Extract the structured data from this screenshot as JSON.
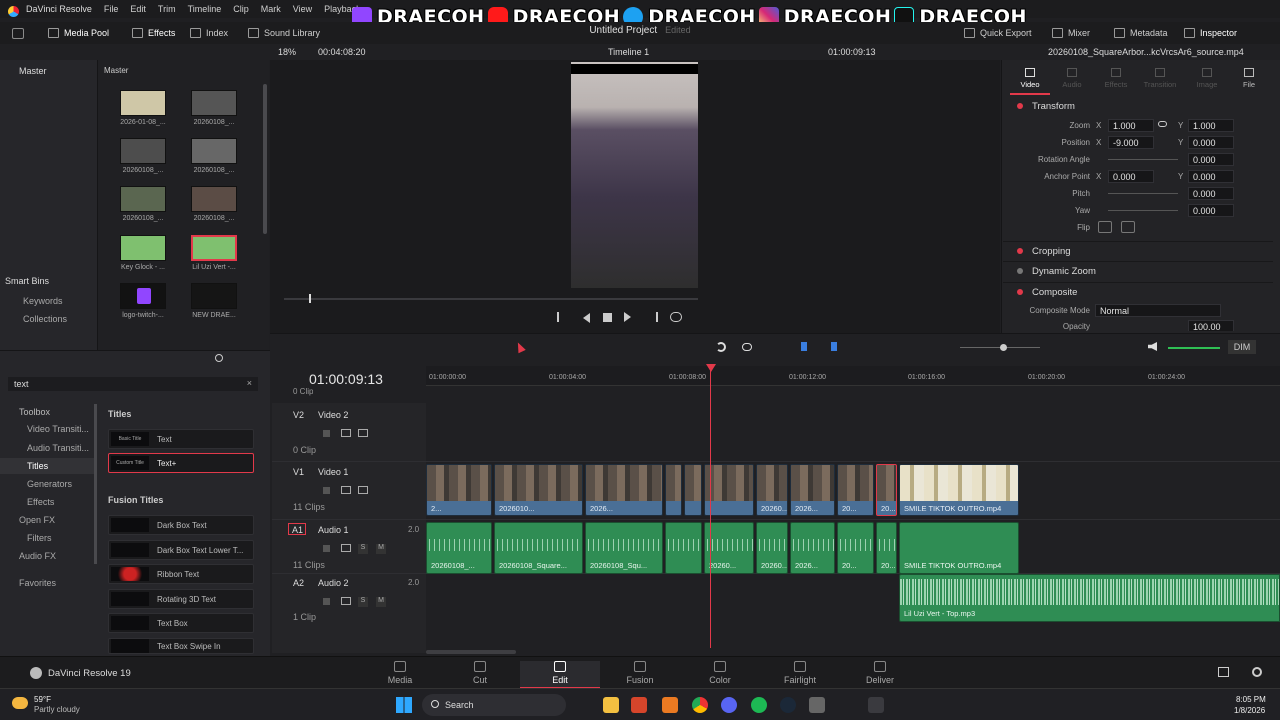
{
  "app_name": "DaVinci Resolve",
  "menu": [
    "File",
    "Edit",
    "Trim",
    "Timeline",
    "Clip",
    "Mark",
    "View",
    "Playback"
  ],
  "social_handles": [
    "DRAECOH",
    "DRAECOH",
    "DRAECOH",
    "DRAECOH",
    "DRAECOH"
  ],
  "project": {
    "title": "Untitled Project",
    "status": "Edited"
  },
  "toolbar": {
    "media_pool": "Media Pool",
    "effects": "Effects",
    "index": "Index",
    "sound_library": "Sound Library",
    "quick_export": "Quick Export",
    "mixer": "Mixer",
    "metadata": "Metadata",
    "inspector": "Inspector"
  },
  "viewer": {
    "zoom": "18%",
    "timecode_left": "00:04:08:20",
    "timeline_name": "Timeline 1",
    "timecode_right": "01:00:09:13",
    "source_name": "20260108_SquareArbor...kcVrcsAr6_source.mp4"
  },
  "bins": {
    "master": "Master",
    "pool_master": "Master",
    "smart_bins": "Smart Bins",
    "keywords": "Keywords",
    "collections": "Collections"
  },
  "media_items": [
    {
      "label": "2026-01-08_..."
    },
    {
      "label": "20260108_..."
    },
    {
      "label": "20260108_..."
    },
    {
      "label": "20260108_..."
    },
    {
      "label": "20260108_..."
    },
    {
      "label": "20260108_..."
    },
    {
      "label": "Key Glock - ..."
    },
    {
      "label": "Lil Uzi Vert -..."
    },
    {
      "label": "logo-twitch-..."
    },
    {
      "label": "NEW DRAE..."
    }
  ],
  "effects": {
    "search_value": "text",
    "tree": {
      "toolbox": "Toolbox",
      "video_transitions": "Video Transiti...",
      "audio_transitions": "Audio Transiti...",
      "titles": "Titles",
      "generators": "Generators",
      "effects": "Effects",
      "open_fx": "Open FX",
      "filters": "Filters",
      "audio_fx": "Audio FX",
      "favorites": "Favorites"
    },
    "titles_header": "Titles",
    "titles": [
      {
        "thumb": "Basic Title",
        "label": "Text"
      },
      {
        "thumb": "Custom Title",
        "label": "Text+"
      }
    ],
    "fusion_header": "Fusion Titles",
    "fusion_titles": [
      {
        "label": "Dark Box Text"
      },
      {
        "label": "Dark Box Text Lower T..."
      },
      {
        "label": "Ribbon Text"
      },
      {
        "label": "Rotating 3D Text"
      },
      {
        "label": "Text Box"
      },
      {
        "label": "Text Box Swipe In"
      }
    ]
  },
  "inspector": {
    "tabs": [
      "Video",
      "Audio",
      "Effects",
      "Transition",
      "Image",
      "File"
    ],
    "transform": "Transform",
    "zoom_label": "Zoom",
    "zoom_x": "1.000",
    "zoom_y": "1.000",
    "position_label": "Position",
    "pos_x": "-9.000",
    "pos_y": "0.000",
    "rotation_label": "Rotation Angle",
    "rotation": "0.000",
    "anchor_label": "Anchor Point",
    "anchor_x": "0.000",
    "anchor_y": "0.000",
    "pitch_label": "Pitch",
    "pitch": "0.000",
    "yaw_label": "Yaw",
    "yaw": "0.000",
    "flip_label": "Flip",
    "x": "X",
    "y": "Y",
    "cropping": "Cropping",
    "dynamic_zoom": "Dynamic Zoom",
    "composite": "Composite",
    "composite_mode_label": "Composite Mode",
    "composite_mode": "Normal",
    "opacity_label": "Opacity",
    "opacity": "100.00"
  },
  "timeline": {
    "timecode": "01:00:09:13",
    "ruler": [
      "01:00:00:00",
      "01:00:04:00",
      "01:00:08:00",
      "01:00:12:00",
      "01:00:16:00",
      "01:00:20:00",
      "01:00:24:00"
    ],
    "dim": "DIM",
    "top_clip": "0 Clip",
    "tracks": [
      {
        "id": "V2",
        "name": "Video 2",
        "count": "0 Clip"
      },
      {
        "id": "V1",
        "name": "Video 1",
        "count": "11 Clips"
      },
      {
        "id": "A1",
        "name": "Audio 1",
        "count": "11 Clips",
        "level": "2.0"
      },
      {
        "id": "A2",
        "name": "Audio 2",
        "count": "1 Clip",
        "level": "2.0"
      }
    ],
    "solo": "S",
    "mute": "M",
    "v1_clips": [
      "2...",
      "2026010...",
      "2026...",
      "",
      "",
      "",
      "20260...",
      "2026...",
      "20...",
      "20...",
      "SMILE TIKTOK OUTRO.mp4"
    ],
    "a1_clips": [
      "20260108_...",
      "20260108_Square...",
      "20260108_Squ...",
      "",
      "20260...",
      "20260...",
      "2026...",
      "20...",
      "20...",
      "SMILE TIKTOK OUTRO.mp4"
    ],
    "a2_clip": "Lil Uzi Vert - Top.mp3"
  },
  "pages": [
    "Media",
    "Cut",
    "Edit",
    "Fusion",
    "Color",
    "Fairlight",
    "Deliver"
  ],
  "version_label": "DaVinci Resolve 19",
  "taskbar": {
    "temp": "59°F",
    "weather": "Partly cloudy",
    "search": "Search",
    "time": "8:05 PM",
    "date": "1/8/2026"
  },
  "colors": {
    "accent_red": "#e2394a",
    "video_clip": "#4a6f96",
    "audio_clip": "#2f8d54",
    "playhead": "#e2394a"
  }
}
